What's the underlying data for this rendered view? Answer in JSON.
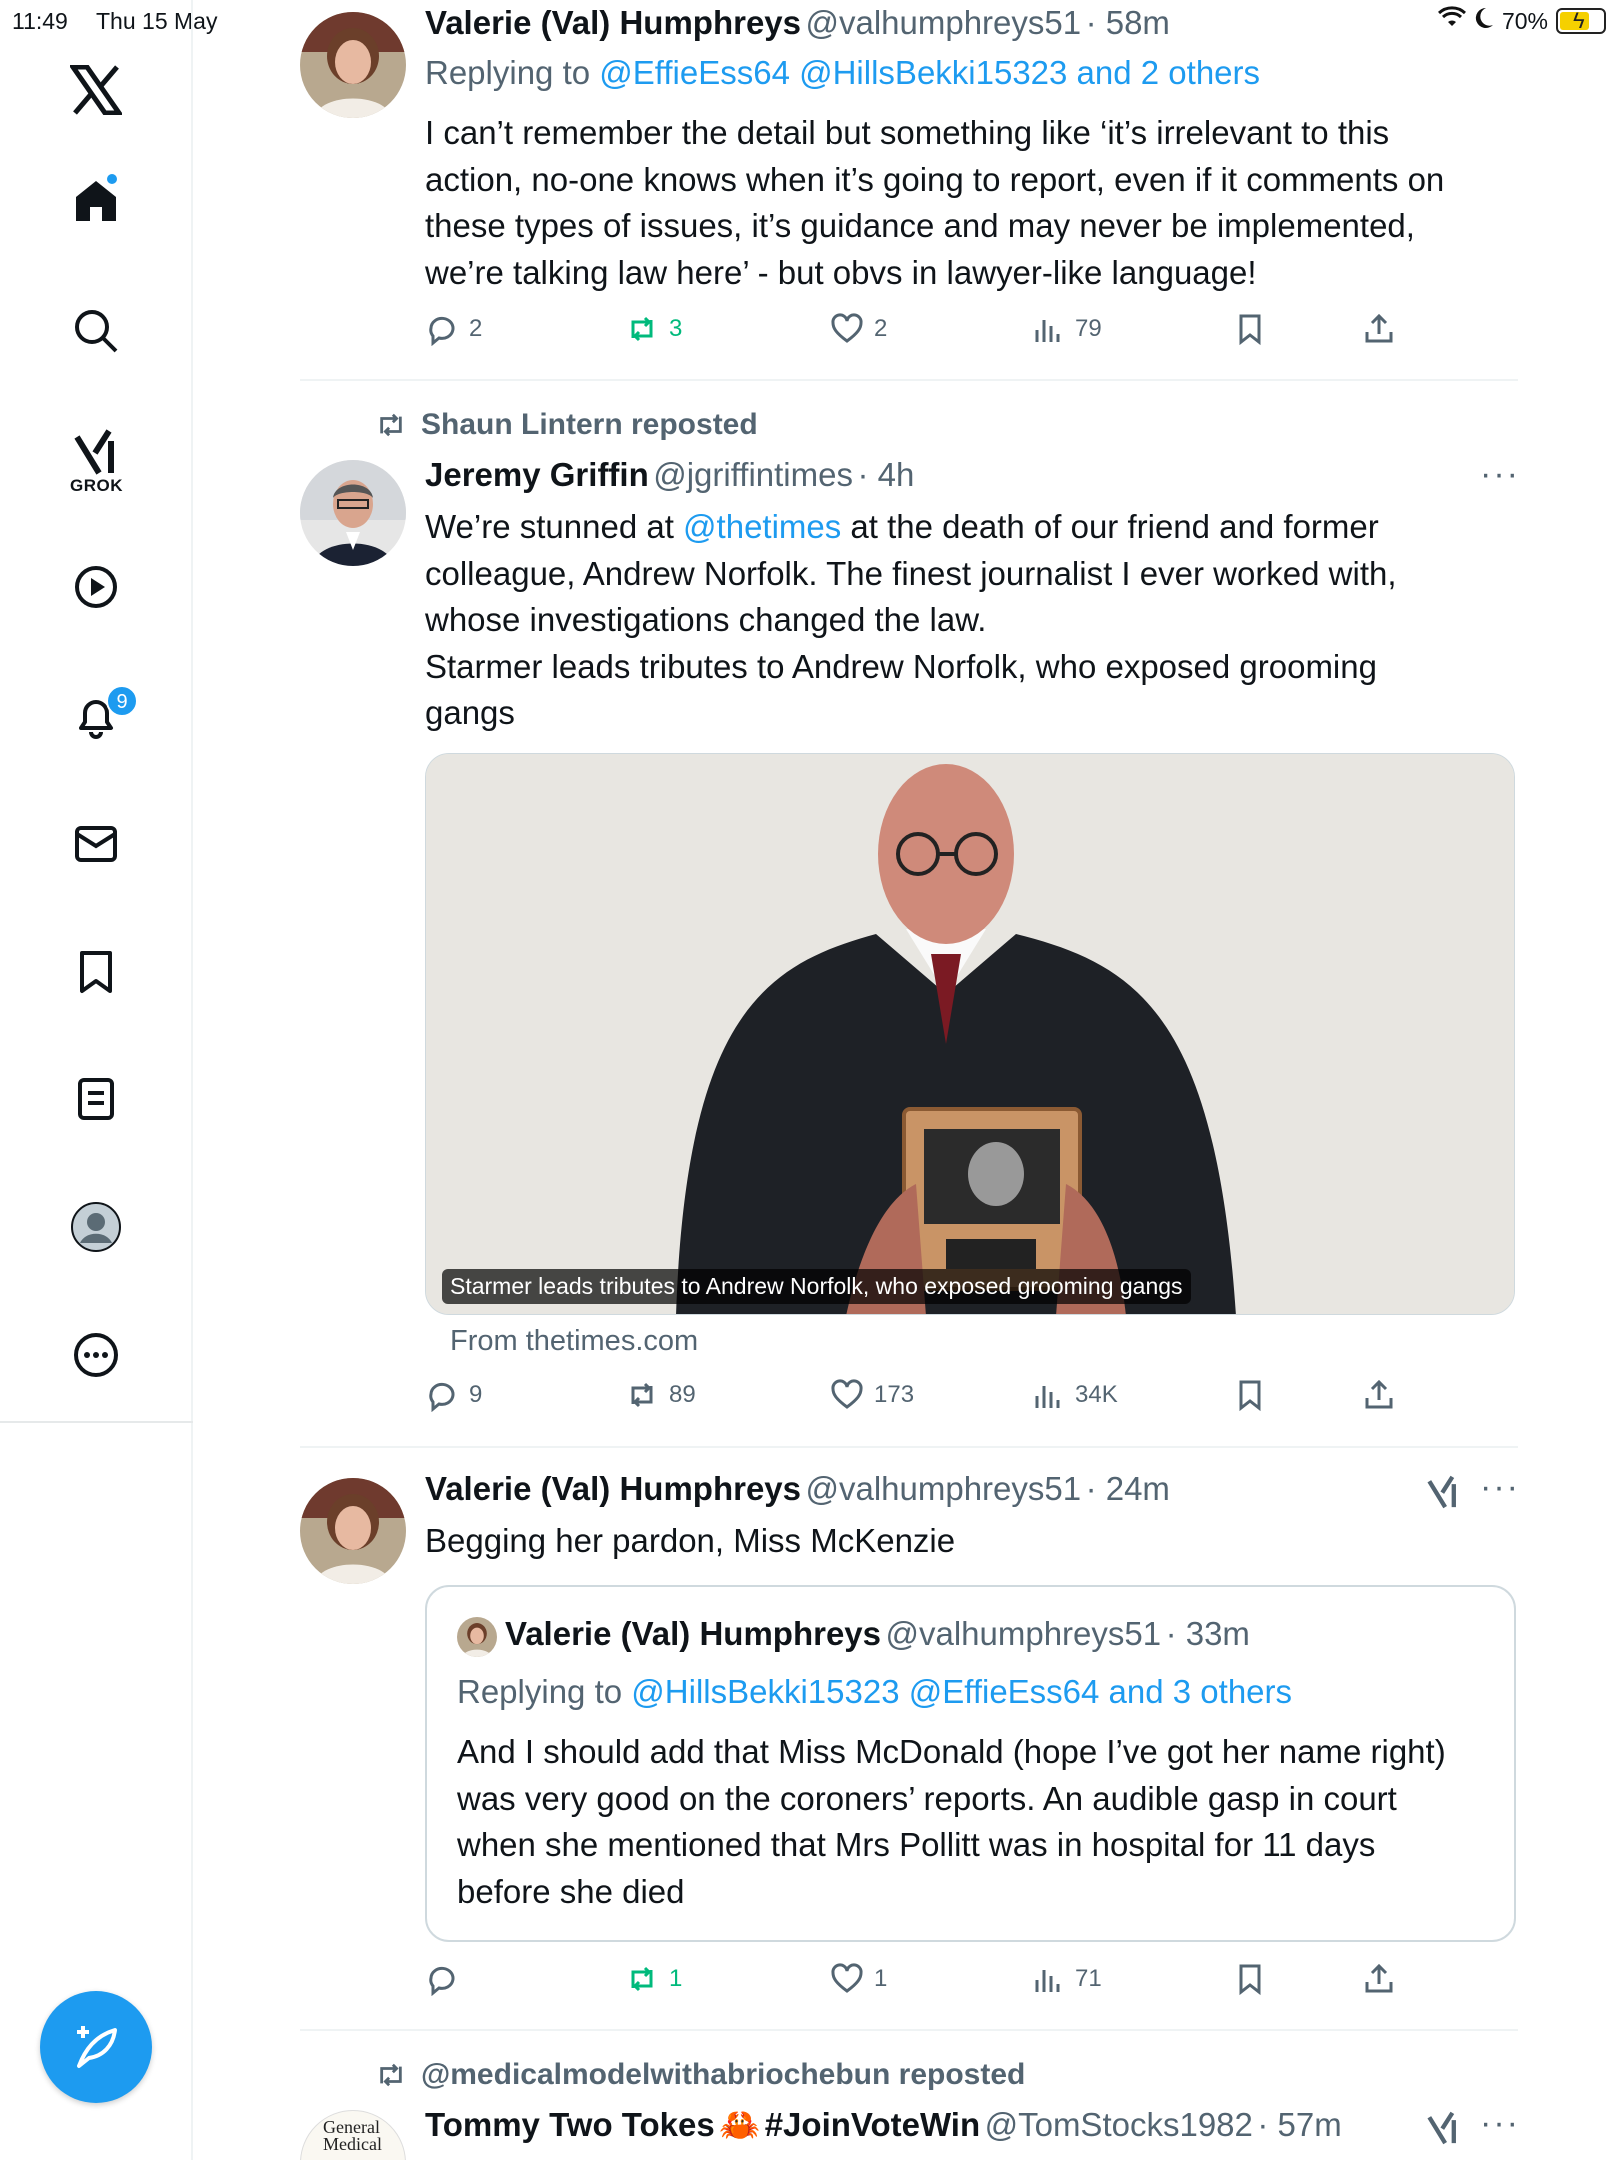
{
  "status_bar": {
    "time": "11:49",
    "date": "Thu 15 May",
    "battery": "70%",
    "battery_level": 0.7
  },
  "sidebar": {
    "grok_label": "GROK",
    "notifications_count": "9",
    "items": [
      "x-logo-icon",
      "home-icon",
      "search-icon",
      "grok-icon",
      "video-icon",
      "notifications-icon",
      "messages-icon",
      "bookmarks-icon",
      "lists-icon",
      "profile-icon",
      "more-icon"
    ]
  },
  "posts": [
    {
      "name": "Valerie (Val) Humphreys",
      "handle": "@valhumphreys51",
      "time": "· 58m",
      "replying_prefix": "Replying to",
      "replying_to": "@EffieEss64 @HillsBekki15323 and 2 others",
      "text": [
        "I can’t remember the detail but something like ‘it’s irrelevant to this",
        "action, no-one knows when it’s going to report, even if it comments on",
        "these types of issues, it’s guidance and may never be implemented,",
        "we’re talking law here’ - but obvs in lawyer-like language!"
      ],
      "replies": "2",
      "reposts": "3",
      "likes": "2",
      "views": "79"
    },
    {
      "reposted_by": "Shaun Lintern reposted",
      "name": "Jeremy Griffin",
      "handle": "@jgriffintimes",
      "time": "· 4h",
      "text_pre": "We’re stunned at ",
      "text_mention": "@thetimes",
      "text_line1_rest": " at the death of our friend and former",
      "text": [
        "colleague, Andrew Norfolk. The finest journalist I ever worked with,",
        "whose investigations changed the law.",
        "Starmer leads tributes to Andrew Norfolk, who exposed grooming",
        "gangs"
      ],
      "media_caption": "Starmer leads tributes to Andrew Norfolk, who exposed grooming gangs",
      "from": "From thetimes.com",
      "replies": "9",
      "reposts": "89",
      "likes": "173",
      "views": "34K"
    },
    {
      "name": "Valerie (Val) Humphreys",
      "handle": "@valhumphreys51",
      "time": "· 24m",
      "text": [
        "Begging her pardon, Miss McKenzie"
      ],
      "quote": {
        "name": "Valerie (Val) Humphreys",
        "handle": "@valhumphreys51",
        "time": "· 33m",
        "replying_prefix": "Replying to",
        "replying_to": "@HillsBekki15323 @EffieEss64 and 3 others",
        "text": [
          "And I should add that Miss McDonald (hope I’ve got her name right)",
          "was very good on the coroners’ reports. An audible gasp in court",
          "when she mentioned that Mrs Pollitt was in hospital for 11 days",
          "before she died"
        ]
      },
      "reposts": "1",
      "likes": "1",
      "views": "71"
    },
    {
      "reposted_by": "@medicalmodelwithabriochebun reposted",
      "name": "Tommy Two Tokes",
      "emoji": "🦀",
      "hashtag": "#JoinVoteWin",
      "handle": "@TomStocks1982",
      "time": "· 57m",
      "avatar_text_1": "General",
      "avatar_text_2": "Medical"
    }
  ]
}
